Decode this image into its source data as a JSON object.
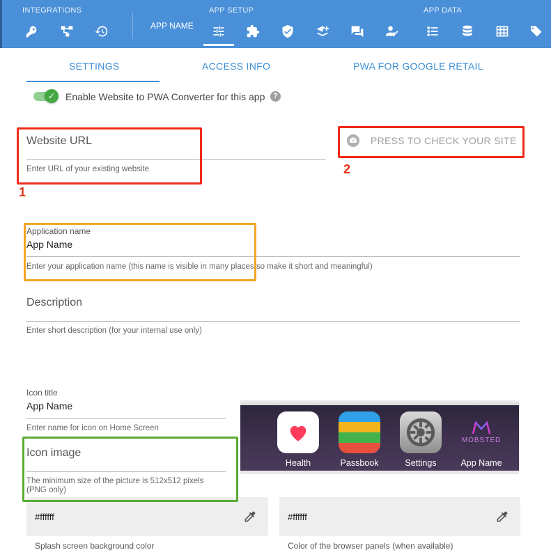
{
  "topbar": {
    "groups": {
      "integrations": "INTEGRATIONS",
      "app_setup": "APP SETUP",
      "app_data": "APP DATA"
    },
    "app_name_label": "APP NAME",
    "icons": [
      "key-icon",
      "network-icon",
      "history-icon",
      "sliders-icon",
      "puzzle-icon",
      "shield-check-icon",
      "layers-add-icon",
      "chat-bubbles-icon",
      "user-check-icon",
      "list-icon",
      "database-icon",
      "table-icon",
      "tags-icon"
    ],
    "colors": {
      "bar": "#4a90d9"
    }
  },
  "tabs": {
    "settings": "SETTINGS",
    "access_info": "ACCESS INFO",
    "pwa_retail": "PWA FOR GOOGLE RETAIL"
  },
  "toggle": {
    "label": "Enable Website to PWA Converter for this app",
    "checked": true,
    "help": "?"
  },
  "form": {
    "website_url": {
      "label": "Website URL",
      "hint": "Enter URL of your existing website"
    },
    "check_button": "PRESS TO CHECK YOUR SITE",
    "app_name": {
      "label": "Application name",
      "value": "App Name",
      "hint": "Enter your application name (this name is visible in many places so make it short and meaningful)"
    },
    "description": {
      "label": "Description",
      "hint": "Enter short description (for your internal use only)"
    },
    "icon_title": {
      "label": "Icon title",
      "value": "App Name",
      "hint": "Enter name for icon on Home Screen"
    },
    "icon_image": {
      "label": "Icon image",
      "hint": "The minimum size of the picture is 512x512 pixels (PNG only)"
    },
    "splash_color": {
      "value": "#ffffff",
      "hint": "Splash screen background color"
    },
    "browser_color": {
      "value": "#ffffff",
      "hint": "Color of the browser panels (when available)"
    }
  },
  "annotations": {
    "num1": "1",
    "num2": "2"
  },
  "phone_preview": {
    "apps": [
      {
        "name": "Health",
        "icon": "heart-icon"
      },
      {
        "name": "Passbook",
        "icon": "passbook-icon"
      },
      {
        "name": "Settings",
        "icon": "settings-gear-icon"
      },
      {
        "name": "App Name",
        "icon": "mobsted-logo"
      }
    ],
    "logo_text": "MOBSTED"
  }
}
